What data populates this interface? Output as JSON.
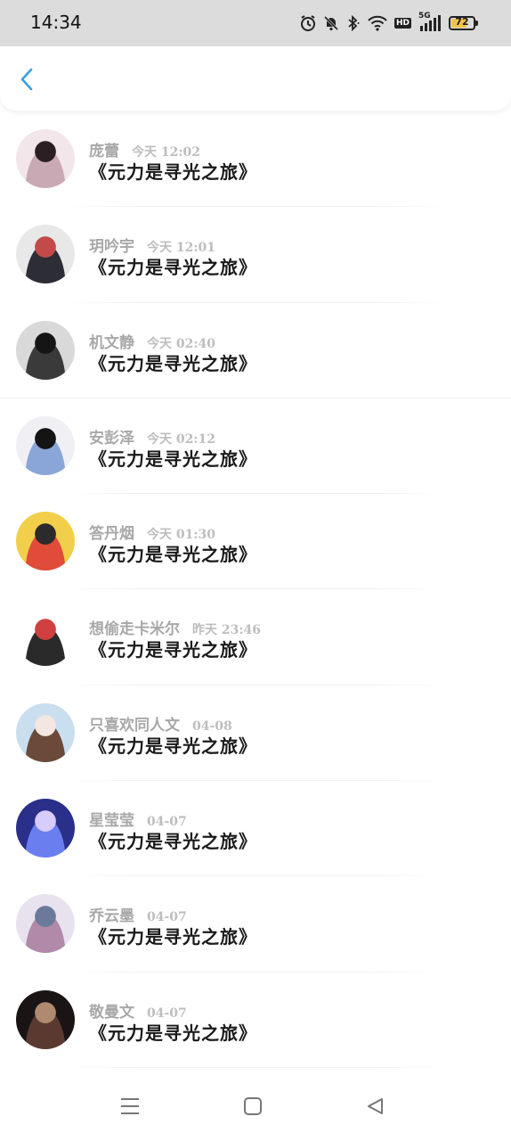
{
  "status_bar": {
    "time": "14:34",
    "icons": [
      "alarm-icon",
      "mute-icon",
      "bluetooth-icon",
      "wifi-icon",
      "hd-icon",
      "signal-5g-icon",
      "battery-icon"
    ],
    "hd_label": "HD",
    "network_label": "5G",
    "battery_level": "72",
    "battery_color": "#f1c24a"
  },
  "header": {
    "back_icon": "chevron-left-icon",
    "accent": "#3aa0e0"
  },
  "messages": [
    {
      "name": "庞蕾",
      "time": "今天 12:02",
      "text": "《元力是寻光之旅》",
      "avatar_colors": [
        "#f2e6ea",
        "#c9a9b4",
        "#2b1f24"
      ]
    },
    {
      "name": "玥吟宇",
      "time": "今天 12:01",
      "text": "《元力是寻光之旅》",
      "avatar_colors": [
        "#e8e8e8",
        "#2d2d36",
        "#c44a4a"
      ]
    },
    {
      "name": "机文静",
      "time": "今天 02:40",
      "text": "《元力是寻光之旅》",
      "avatar_colors": [
        "#d9d9d9",
        "#3a3a3a",
        "#151515"
      ]
    },
    {
      "name": "安彭泽",
      "time": "今天 02:12",
      "text": "《元力是寻光之旅》",
      "avatar_colors": [
        "#f0f0f4",
        "#8aa6d8",
        "#141414"
      ]
    },
    {
      "name": "答丹烟",
      "time": "今天 01:30",
      "text": "《元力是寻光之旅》",
      "avatar_colors": [
        "#f1cf4a",
        "#e04b3a",
        "#2b2b2b"
      ]
    },
    {
      "name": "想偷走卡米尔",
      "time": "昨天 23:46",
      "text": "《元力是寻光之旅》",
      "avatar_colors": [
        "#ffffff",
        "#2a2a2a",
        "#d04040"
      ]
    },
    {
      "name": "只喜欢同人文",
      "time": "04-08",
      "text": "《元力是寻光之旅》",
      "avatar_colors": [
        "#c9dff0",
        "#6b4a3a",
        "#f4e6e0"
      ]
    },
    {
      "name": "星莹莹",
      "time": "04-07",
      "text": "《元力是寻光之旅》",
      "avatar_colors": [
        "#2a2f8a",
        "#6a7ef0",
        "#d8ccff"
      ]
    },
    {
      "name": "乔云墨",
      "time": "04-07",
      "text": "《元力是寻光之旅》",
      "avatar_colors": [
        "#e8e2ee",
        "#b08aa8",
        "#6b7a9a"
      ]
    },
    {
      "name": "敬曼文",
      "time": "04-07",
      "text": "《元力是寻光之旅》",
      "avatar_colors": [
        "#1a1414",
        "#5a3a30",
        "#b08a70"
      ]
    }
  ],
  "navbar": {
    "buttons": [
      "menu-icon",
      "home-icon",
      "back-triangle-icon"
    ]
  }
}
